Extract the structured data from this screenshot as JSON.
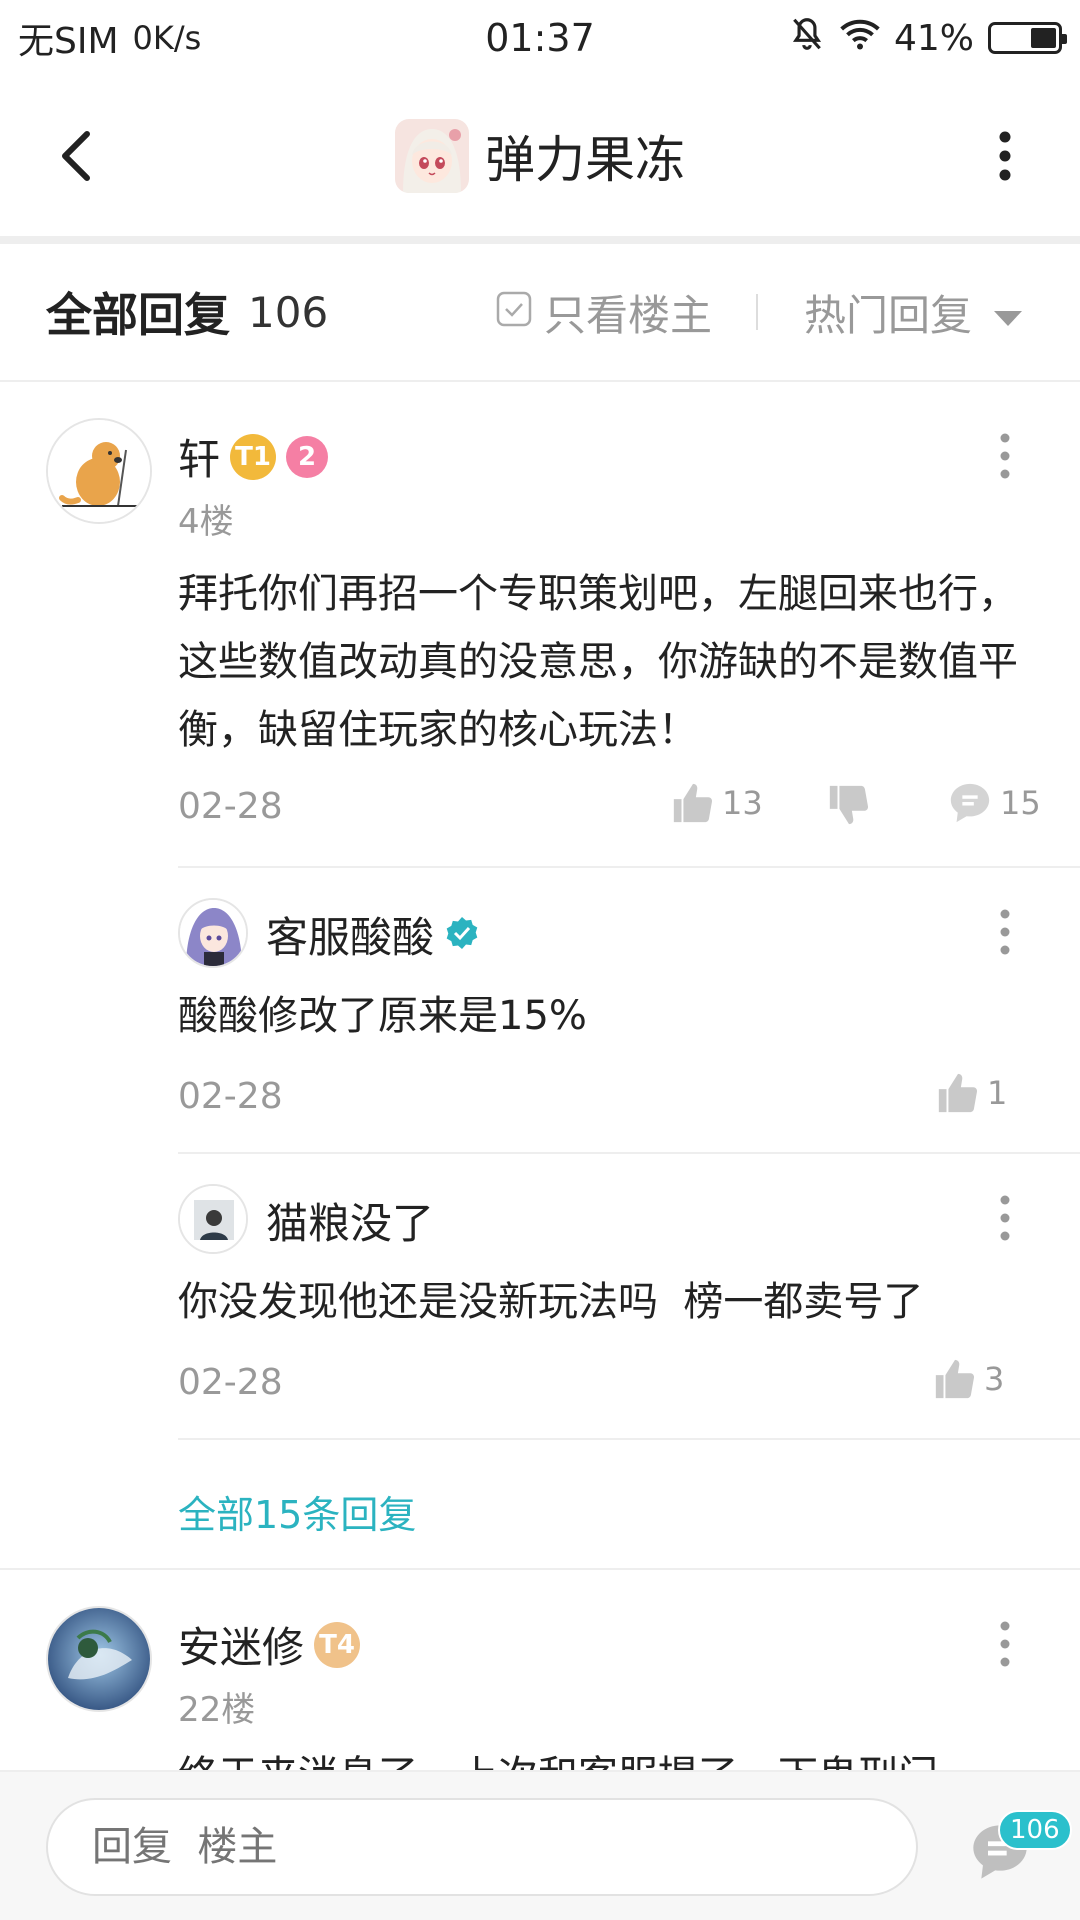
{
  "status_bar": {
    "carrier": "无SIM",
    "speed": "0K/s",
    "time": "01:37",
    "battery": "41%",
    "battery_level": 0.41,
    "icons": [
      "mute-bell-icon",
      "wifi-icon",
      "battery-icon"
    ]
  },
  "header": {
    "title": "弹力果冻",
    "back_icon": "back-chevron-icon",
    "more_icon": "more-vertical-icon"
  },
  "filter_bar": {
    "all_replies_label": "全部回复",
    "count": "106",
    "only_op_label": "只看楼主",
    "sort_label": "热门回复"
  },
  "comments": [
    {
      "user": "轩",
      "badges": [
        "T1",
        "2"
      ],
      "floor": "4楼",
      "content": "拜托你们再招一个专职策划吧，左腿回来也行，这些数值改动真的没意思，你游缺的不是数值平衡，缺留住玩家的核心玩法！",
      "date": "02-28",
      "likes": "13",
      "replies": "15",
      "sub_replies": [
        {
          "user": "客服酸酸",
          "verified": true,
          "content": "酸酸修改了原来是15%",
          "date": "02-28",
          "likes": "1"
        },
        {
          "user": "猫粮没了",
          "content": "你没发现他还是没新玩法吗  榜一都卖号了",
          "date": "02-28",
          "likes": "3"
        }
      ],
      "more_replies_label": "全部15条回复"
    },
    {
      "user": "安迷修",
      "badges": [
        "T4"
      ],
      "floor": "22楼",
      "content": "终于来消息了，上次和客服提了一下鬼刑门"
    }
  ],
  "bottom_bar": {
    "placeholder": "回复  楼主",
    "comment_count_badge": "106"
  },
  "colors": {
    "accent": "#2bb3c0",
    "badge_gold": "#f2b93b",
    "badge_pink": "#f57fa4",
    "muted": "#999999"
  }
}
